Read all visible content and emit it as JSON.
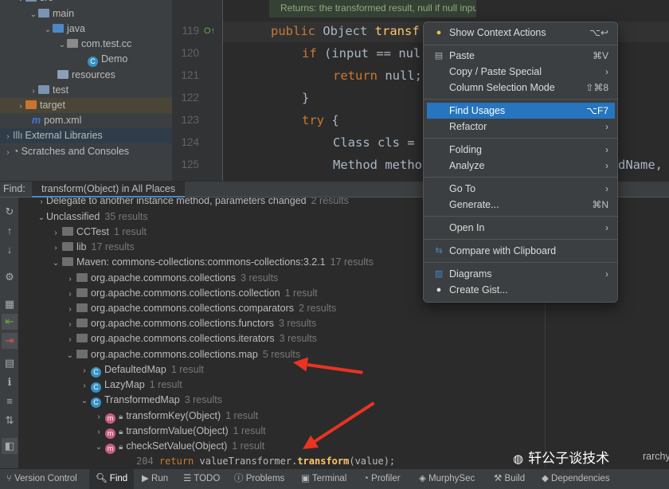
{
  "project_tree": {
    "items": [
      {
        "label": "src"
      },
      {
        "label": "main"
      },
      {
        "label": "java"
      },
      {
        "label": "com.test.cc"
      },
      {
        "label": "Demo"
      },
      {
        "label": "resources"
      },
      {
        "label": "test"
      },
      {
        "label": "target"
      },
      {
        "label": "pom.xml"
      },
      {
        "label": "External Libraries"
      },
      {
        "label": "Scratches and Consoles"
      }
    ]
  },
  "editor": {
    "doc_comment": "Returns: the transformed result, null if null input",
    "line_numbers": [
      "119",
      "120",
      "121",
      "122",
      "123",
      "124",
      "125"
    ],
    "lines": [
      {
        "kw": "public",
        "text": " Object ",
        "fn": "transf"
      },
      {
        "kw": "if",
        "text": " (input == nul",
        "fn": ""
      },
      {
        "kw": "return",
        "text": " null;",
        "fn": ""
      },
      {
        "kw": "",
        "text": "}",
        "fn": ""
      },
      {
        "kw": "try",
        "text": " {",
        "fn": ""
      },
      {
        "kw": "",
        "text": "Class cls = ",
        "fn": ""
      },
      {
        "kw": "",
        "text": "Method metho",
        "fn": ""
      }
    ],
    "overflow_text": "dName,"
  },
  "find_bar": {
    "label": "Find:",
    "tab": "transform(Object) in All Places"
  },
  "results": {
    "partial_top": {
      "label": "Delegate to another instance method, parameters changed",
      "count": "2 results"
    },
    "rows": [
      {
        "label": "Unclassified",
        "count": "35 results"
      },
      {
        "label": "CCTest",
        "count": "1 result"
      },
      {
        "label": "lib",
        "count": "17 results"
      },
      {
        "label": "Maven: commons-collections:commons-collections:3.2.1",
        "count": "17 results"
      },
      {
        "label": "org.apache.commons.collections",
        "count": "3 results"
      },
      {
        "label": "org.apache.commons.collections.collection",
        "count": "1 result"
      },
      {
        "label": "org.apache.commons.collections.comparators",
        "count": "2 results"
      },
      {
        "label": "org.apache.commons.collections.functors",
        "count": "3 results"
      },
      {
        "label": "org.apache.commons.collections.iterators",
        "count": "3 results"
      },
      {
        "label": "org.apache.commons.collections.map",
        "count": "5 results"
      },
      {
        "label": "DefaultedMap",
        "count": "1 result"
      },
      {
        "label": "LazyMap",
        "count": "1 result"
      },
      {
        "label": "TransformedMap",
        "count": "3 results"
      },
      {
        "label": "transformKey(Object)",
        "count": "1 result"
      },
      {
        "label": "transformValue(Object)",
        "count": "1 result"
      },
      {
        "label": "checkSetValue(Object)",
        "count": "1 result"
      }
    ],
    "code_line": {
      "num": "204",
      "kw": "return",
      "pre": " valueTransformer.",
      "fn": "transform",
      "post": "(value);"
    },
    "right_partial": "rarchy"
  },
  "context_menu": {
    "items": [
      {
        "label": "Show Context Actions",
        "shortcut": "⌥↩",
        "icon": "lightbulb-icon"
      },
      {
        "label": "Paste",
        "shortcut": "⌘V",
        "icon": "clipboard-icon"
      },
      {
        "label": "Copy / Paste Special",
        "shortcut": "›",
        "icon": ""
      },
      {
        "label": "Column Selection Mode",
        "shortcut": "⇧⌘8",
        "icon": ""
      },
      {
        "label": "Find Usages",
        "shortcut": "⌥F7",
        "icon": ""
      },
      {
        "label": "Refactor",
        "shortcut": "›",
        "icon": ""
      },
      {
        "label": "Folding",
        "shortcut": "›",
        "icon": ""
      },
      {
        "label": "Analyze",
        "shortcut": "›",
        "icon": ""
      },
      {
        "label": "Go To",
        "shortcut": "›",
        "icon": ""
      },
      {
        "label": "Generate...",
        "shortcut": "⌘N",
        "icon": ""
      },
      {
        "label": "Open In",
        "shortcut": "›",
        "icon": ""
      },
      {
        "label": "Compare with Clipboard",
        "shortcut": "",
        "icon": "compare-icon"
      },
      {
        "label": "Diagrams",
        "shortcut": "›",
        "icon": "diagram-icon"
      },
      {
        "label": "Create Gist...",
        "shortcut": "",
        "icon": "github-icon"
      }
    ]
  },
  "bottom_bar": {
    "tabs": [
      {
        "label": "Version Control"
      },
      {
        "label": "Find"
      },
      {
        "label": "Run"
      },
      {
        "label": "TODO"
      },
      {
        "label": "Problems"
      },
      {
        "label": "Terminal"
      },
      {
        "label": "Profiler"
      },
      {
        "label": "MurphySec"
      },
      {
        "label": "Build"
      },
      {
        "label": "Dependencies"
      }
    ]
  },
  "watermark": "轩公子谈技术",
  "colors": {
    "accent": "#2675bf",
    "arrow": "#ea3323",
    "keyword": "#cc7832",
    "function": "#ffc66d"
  }
}
